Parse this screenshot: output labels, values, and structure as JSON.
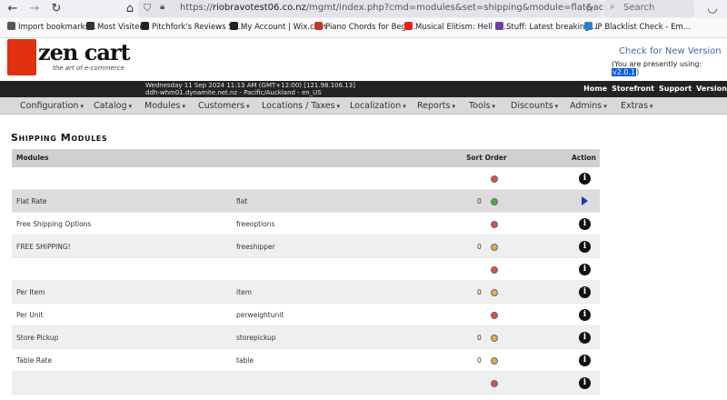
{
  "browser": {
    "url_host": "riobravotest06.co.nz",
    "url_path": "/mgmt/index.php?cmd=modules&set=shipping&module=flat&action=edit",
    "url_scheme": "https://",
    "search_placeholder": "Search"
  },
  "bookmarks": [
    {
      "label": "Import bookmarks...",
      "icon": "import-icon",
      "color": "#555555"
    },
    {
      "label": "Most Visited",
      "icon": "gear-icon",
      "color": "#333333"
    },
    {
      "label": "Pitchfork's Reviews Se...",
      "icon": "pitchfork-icon",
      "color": "#222222"
    },
    {
      "label": "My Account | Wix.com",
      "icon": "wix-icon",
      "color": "#222222"
    },
    {
      "label": "Piano Chords for Begi...",
      "icon": "piano-icon",
      "color": "#c0392b"
    },
    {
      "label": "Musical Elitism: Hell is ...",
      "icon": "youtube-icon",
      "color": "#e62117"
    },
    {
      "label": "Stuff: Latest breaking ...",
      "icon": "stuff-icon",
      "color": "#6b3fa0"
    },
    {
      "label": "IP Blacklist Check - Em...",
      "icon": "shield-icon",
      "color": "#2a7fcf"
    }
  ],
  "header": {
    "logo_text": "zen cart",
    "logo_tagline": "the art of e-commerce",
    "check_version": "Check for New Version",
    "using_prefix": "(You are presently using: ",
    "using_version": "v2.0.1",
    "using_suffix": ")"
  },
  "infobar": {
    "datetime_line": "Wednesday 11 Sep 2024 11:13 AM (GMT+12:00) [121.98.106.13]",
    "host_line": "ddh-whm01.dynamite.net.nz - Pacific/Auckland - en_US",
    "links": [
      "Home",
      "Storefront",
      "Support",
      "Version"
    ]
  },
  "menu": [
    "Configuration",
    "Catalog",
    "Modules",
    "Customers",
    "Locations / Taxes",
    "Localization",
    "Reports",
    "Tools",
    "Discounts",
    "Admins",
    "Extras"
  ],
  "page_title": "Shipping Modules",
  "table": {
    "headers": {
      "modules": "Modules",
      "sort_order": "Sort Order",
      "action": "Action"
    },
    "rows": [
      {
        "title": "",
        "code": "",
        "sort": "",
        "status": "red",
        "action": "info"
      },
      {
        "title": "Flat Rate",
        "code": "flat",
        "sort": "0",
        "status": "green",
        "action": "selected"
      },
      {
        "title": "Free Shipping Options",
        "code": "freeoptions",
        "sort": "",
        "status": "red",
        "action": "info"
      },
      {
        "title": "FREE SHIPPING!",
        "code": "freeshipper",
        "sort": "0",
        "status": "amber",
        "action": "info"
      },
      {
        "title": "",
        "code": "",
        "sort": "",
        "status": "red",
        "action": "info"
      },
      {
        "title": "Per Item",
        "code": "item",
        "sort": "0",
        "status": "amber",
        "action": "info"
      },
      {
        "title": "Per Unit",
        "code": "perweightunit",
        "sort": "",
        "status": "red",
        "action": "info"
      },
      {
        "title": "Store Pickup",
        "code": "storepickup",
        "sort": "0",
        "status": "amber",
        "action": "info"
      },
      {
        "title": "Table Rate",
        "code": "table",
        "sort": "0",
        "status": "amber",
        "action": "info"
      },
      {
        "title": "",
        "code": "",
        "sort": "",
        "status": "red",
        "action": "info"
      }
    ]
  }
}
